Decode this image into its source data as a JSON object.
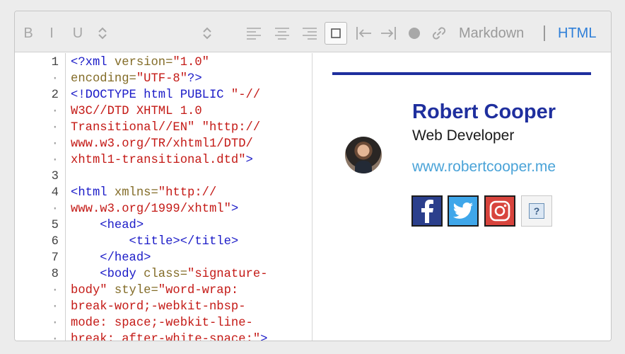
{
  "toolbar": {
    "bold_label": "B",
    "italic_label": "I",
    "underline_label": "U",
    "mode_markdown": "Markdown",
    "mode_separator": "|",
    "mode_html": "HTML",
    "colors": {
      "icon": "#a8a8a8",
      "active_mode": "#2f7fd8"
    }
  },
  "editor": {
    "lines": [
      {
        "num": "1",
        "tokens": [
          {
            "t": "<?xml ",
            "c": "blue"
          },
          {
            "t": "version=",
            "c": "olive"
          },
          {
            "t": "\"1.0\"",
            "c": "red"
          }
        ]
      },
      {
        "num": "·",
        "tokens": [
          {
            "t": "encoding=",
            "c": "olive"
          },
          {
            "t": "\"UTF-8\"",
            "c": "red"
          },
          {
            "t": "?>",
            "c": "blue"
          }
        ]
      },
      {
        "num": "2",
        "tokens": [
          {
            "t": "<!DOCTYPE html PUBLIC ",
            "c": "blue"
          },
          {
            "t": "\"-//",
            "c": "red"
          }
        ]
      },
      {
        "num": "·",
        "tokens": [
          {
            "t": "W3C//DTD XHTML 1.0",
            "c": "red"
          }
        ]
      },
      {
        "num": "·",
        "tokens": [
          {
            "t": "Transitional//EN\" \"http://",
            "c": "red"
          }
        ]
      },
      {
        "num": "·",
        "tokens": [
          {
            "t": "www.w3.org/TR/xhtml1/DTD/",
            "c": "red"
          }
        ]
      },
      {
        "num": "·",
        "tokens": [
          {
            "t": "xhtml1-transitional.dtd\"",
            "c": "red"
          },
          {
            "t": ">",
            "c": "blue"
          }
        ]
      },
      {
        "num": "3",
        "tokens": []
      },
      {
        "num": "4",
        "tokens": [
          {
            "t": "<html ",
            "c": "blue"
          },
          {
            "t": "xmlns=",
            "c": "olive"
          },
          {
            "t": "\"http://",
            "c": "red"
          }
        ]
      },
      {
        "num": "·",
        "tokens": [
          {
            "t": "www.w3.org/1999/xhtml\"",
            "c": "red"
          },
          {
            "t": ">",
            "c": "blue"
          }
        ]
      },
      {
        "num": "5",
        "tokens": [
          {
            "t": "    <head>",
            "c": "blue"
          }
        ]
      },
      {
        "num": "6",
        "tokens": [
          {
            "t": "        <title></title>",
            "c": "blue"
          }
        ]
      },
      {
        "num": "7",
        "tokens": [
          {
            "t": "    </head>",
            "c": "blue"
          }
        ]
      },
      {
        "num": "8",
        "tokens": [
          {
            "t": "    <body ",
            "c": "blue"
          },
          {
            "t": "class=",
            "c": "olive"
          },
          {
            "t": "\"signature-",
            "c": "red"
          }
        ]
      },
      {
        "num": "·",
        "tokens": [
          {
            "t": "body\" ",
            "c": "red"
          },
          {
            "t": "style=",
            "c": "olive"
          },
          {
            "t": "\"word-wrap:",
            "c": "red"
          }
        ]
      },
      {
        "num": "·",
        "tokens": [
          {
            "t": "break-word;-webkit-nbsp-",
            "c": "red"
          }
        ]
      },
      {
        "num": "·",
        "tokens": [
          {
            "t": "mode: space;-webkit-line-",
            "c": "red"
          }
        ]
      },
      {
        "num": "·",
        "tokens": [
          {
            "t": "break: after-white-space;\"",
            "c": "red"
          },
          {
            "t": ">",
            "c": "blue"
          }
        ]
      }
    ]
  },
  "preview": {
    "name": "Robert Cooper",
    "role": "Web Developer",
    "website": "www.robertcooper.me",
    "colors": {
      "rule": "#1f2f9e",
      "name": "#1f2f9e",
      "link": "#4aa3d8"
    },
    "social": [
      {
        "icon": "facebook-icon",
        "glyph": "f"
      },
      {
        "icon": "twitter-icon"
      },
      {
        "icon": "instagram-icon"
      },
      {
        "icon": "unknown-image-icon",
        "glyph": "?"
      }
    ]
  }
}
